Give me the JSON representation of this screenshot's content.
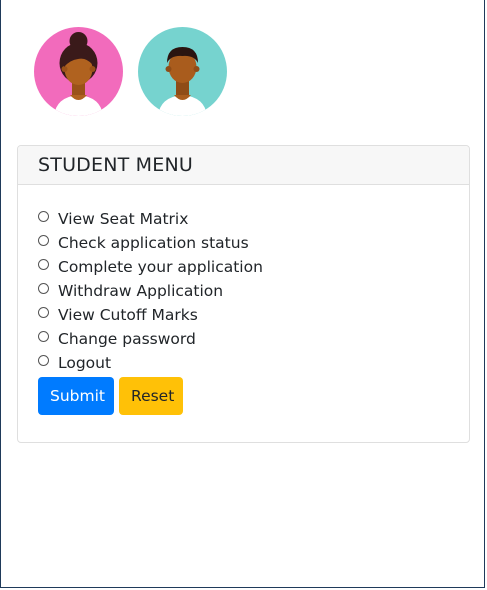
{
  "avatars": [
    {
      "name": "female-student-avatar",
      "bg_color": "#f26bbc",
      "skin_color": "#b0621f"
    },
    {
      "name": "male-student-avatar",
      "bg_color": "#76d3cf",
      "skin_color": "#a95c1d"
    }
  ],
  "card": {
    "title": "STUDENT MENU"
  },
  "options": [
    {
      "label": "View Seat Matrix",
      "checked": false
    },
    {
      "label": "Check application status",
      "checked": false
    },
    {
      "label": "Complete your application",
      "checked": false
    },
    {
      "label": "Withdraw Application",
      "checked": false
    },
    {
      "label": "View Cutoff Marks",
      "checked": false
    },
    {
      "label": "Change password",
      "checked": false
    },
    {
      "label": "Logout",
      "checked": false
    }
  ],
  "buttons": {
    "submit_label": "Submit",
    "reset_label": "Reset",
    "submit_color": "#007bff",
    "reset_color": "#ffc107"
  }
}
